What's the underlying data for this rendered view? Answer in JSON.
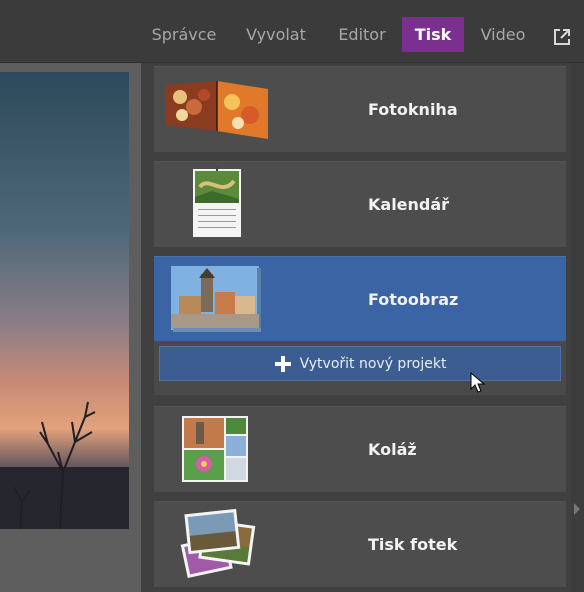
{
  "nav": {
    "tabs": [
      {
        "label": "Správce",
        "active": false
      },
      {
        "label": "Vyvolat",
        "active": false
      },
      {
        "label": "Editor",
        "active": false
      },
      {
        "label": "Tisk",
        "active": true
      },
      {
        "label": "Video",
        "active": false
      }
    ],
    "external_icon": "external-link-icon"
  },
  "print_panel": {
    "products": [
      {
        "label": "Fotokniha",
        "thumb": "photobook-thumbnail"
      },
      {
        "label": "Kalendář",
        "thumb": "calendar-thumbnail"
      },
      {
        "label": "Fotoobraz",
        "thumb": "photo-canvas-thumbnail",
        "selected": true
      },
      {
        "label": "Koláž",
        "thumb": "collage-thumbnail"
      },
      {
        "label": "Tisk fotek",
        "thumb": "photo-prints-thumbnail"
      }
    ],
    "new_project_label": "Vytvořit nový projekt"
  },
  "colors": {
    "active_tab": "#7b2f8f",
    "selected_card": "#3a64a4",
    "new_project_button": "#3c5d92"
  }
}
